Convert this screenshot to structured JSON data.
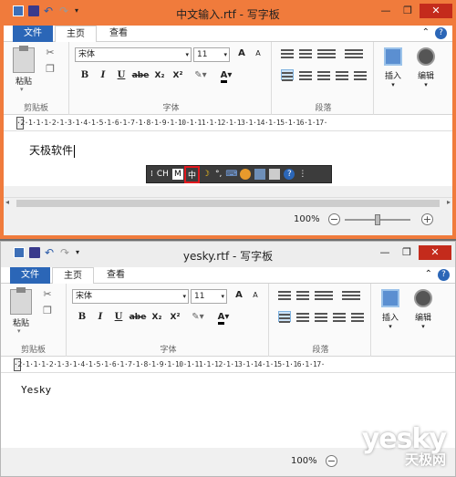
{
  "common": {
    "tab_file": "文件",
    "tab_home": "主页",
    "tab_view": "查看",
    "paste_label": "粘贴",
    "clipboard_group": "剪贴板",
    "font_group": "字体",
    "paragraph_group": "段落",
    "insert_label": "插入",
    "edit_label": "编辑",
    "font_name": "宋体",
    "font_size": "11",
    "bold": "B",
    "italic": "I",
    "underline": "U",
    "strike": "abe",
    "subscript": "X₂",
    "superscript": "X²",
    "zoom": "100%",
    "grow_font": "A",
    "shrink_font": "A",
    "ruler": "·2·1·1·1·2·1·3·1·4·1·5·1·6·1·7·1·8·1·9·1·10·1·11·1·12·1·13·1·14·1·15·1·16·1·17·",
    "help_symbol": "?",
    "font_color_letter": "A",
    "minimize": "—",
    "restore": "❐",
    "close": "✕"
  },
  "window1": {
    "title": "中文输入.rtf - 写字板",
    "content": "天极软件",
    "ime": {
      "cn_mode": "CH",
      "m_label": "M",
      "chinese_char": "中",
      "moon": "☽",
      "punct": "°,",
      "keyboard": "⌨",
      "help": "?",
      "more": "⋮"
    }
  },
  "window2": {
    "title": "yesky.rtf - 写字板",
    "content": "Yesky"
  },
  "watermark": {
    "brand": "yesky",
    "sub": "天极网"
  },
  "colors": {
    "accent_orange": "#f07b3c",
    "file_tab_blue": "#2b66b7",
    "close_red": "#c42b1c",
    "ime_highlight": "#e0181e"
  }
}
